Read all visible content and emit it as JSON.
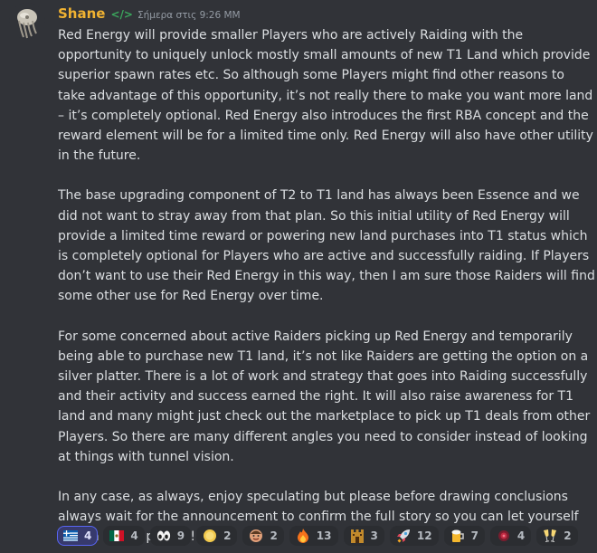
{
  "message": {
    "author": "Shane",
    "author_tag": "</>",
    "timestamp": "Σήμερα στις 9:26 MM",
    "paragraphs": [
      "Red Energy will provide smaller Players who are actively Raiding with the opportunity to uniquely unlock mostly small amounts of new T1 Land which provide superior spawn rates etc. So although some Players might find other reasons to take advantage of this opportunity, it’s not really there to make you want more land – it’s completely optional. Red Energy also introduces the first RBA concept and the reward element will be for a limited time only.  Red Energy will also have other utility in the future.",
      "The base upgrading component of T2 to T1 land has always been Essence and we did not want to stray away from that plan.  So this initial utility of Red Energy will provide a limited time reward or powering new land purchases into T1 status which is completely optional for Players who are active and successfully raiding.  If Players don’t want to use their Red Energy in this way, then I am sure those Raiders will find some other use for Red Energy over time.",
      "For some concerned about active Raiders picking up Red Energy and temporarily being able to purchase new T1 land, it’s not like Raiders are getting the option on a silver platter.  There is a lot of work and strategy that goes into Raiding successfully and their activity and success earned the right.  It will also raise awareness for T1 land and many might just check out the marketplace to pick up T1 deals from other Players.  So there are many different angles you need to consider instead of looking at things with tunnel vision.",
      "In any case, as always, enjoy speculating but please before drawing conclusions always wait for the announcement to confirm the full story so you can let yourself form a better picture!"
    ]
  },
  "reactions": [
    {
      "icon": "greek-flag-icon",
      "count": "4",
      "active": true
    },
    {
      "icon": "mexican-flag-icon",
      "count": "4"
    },
    {
      "icon": "eyes-icon",
      "count": "9"
    },
    {
      "icon": "coin-icon",
      "count": "2"
    },
    {
      "icon": "face-emoji-icon",
      "count": "2"
    },
    {
      "icon": "fire-icon",
      "count": "13"
    },
    {
      "icon": "castle-emoji-icon",
      "count": "3"
    },
    {
      "icon": "rocket-icon",
      "count": "12"
    },
    {
      "icon": "beer-icon",
      "count": "7"
    },
    {
      "icon": "target-emoji-icon",
      "count": "4"
    },
    {
      "icon": "clinking-glasses-icon",
      "count": "2"
    }
  ]
}
